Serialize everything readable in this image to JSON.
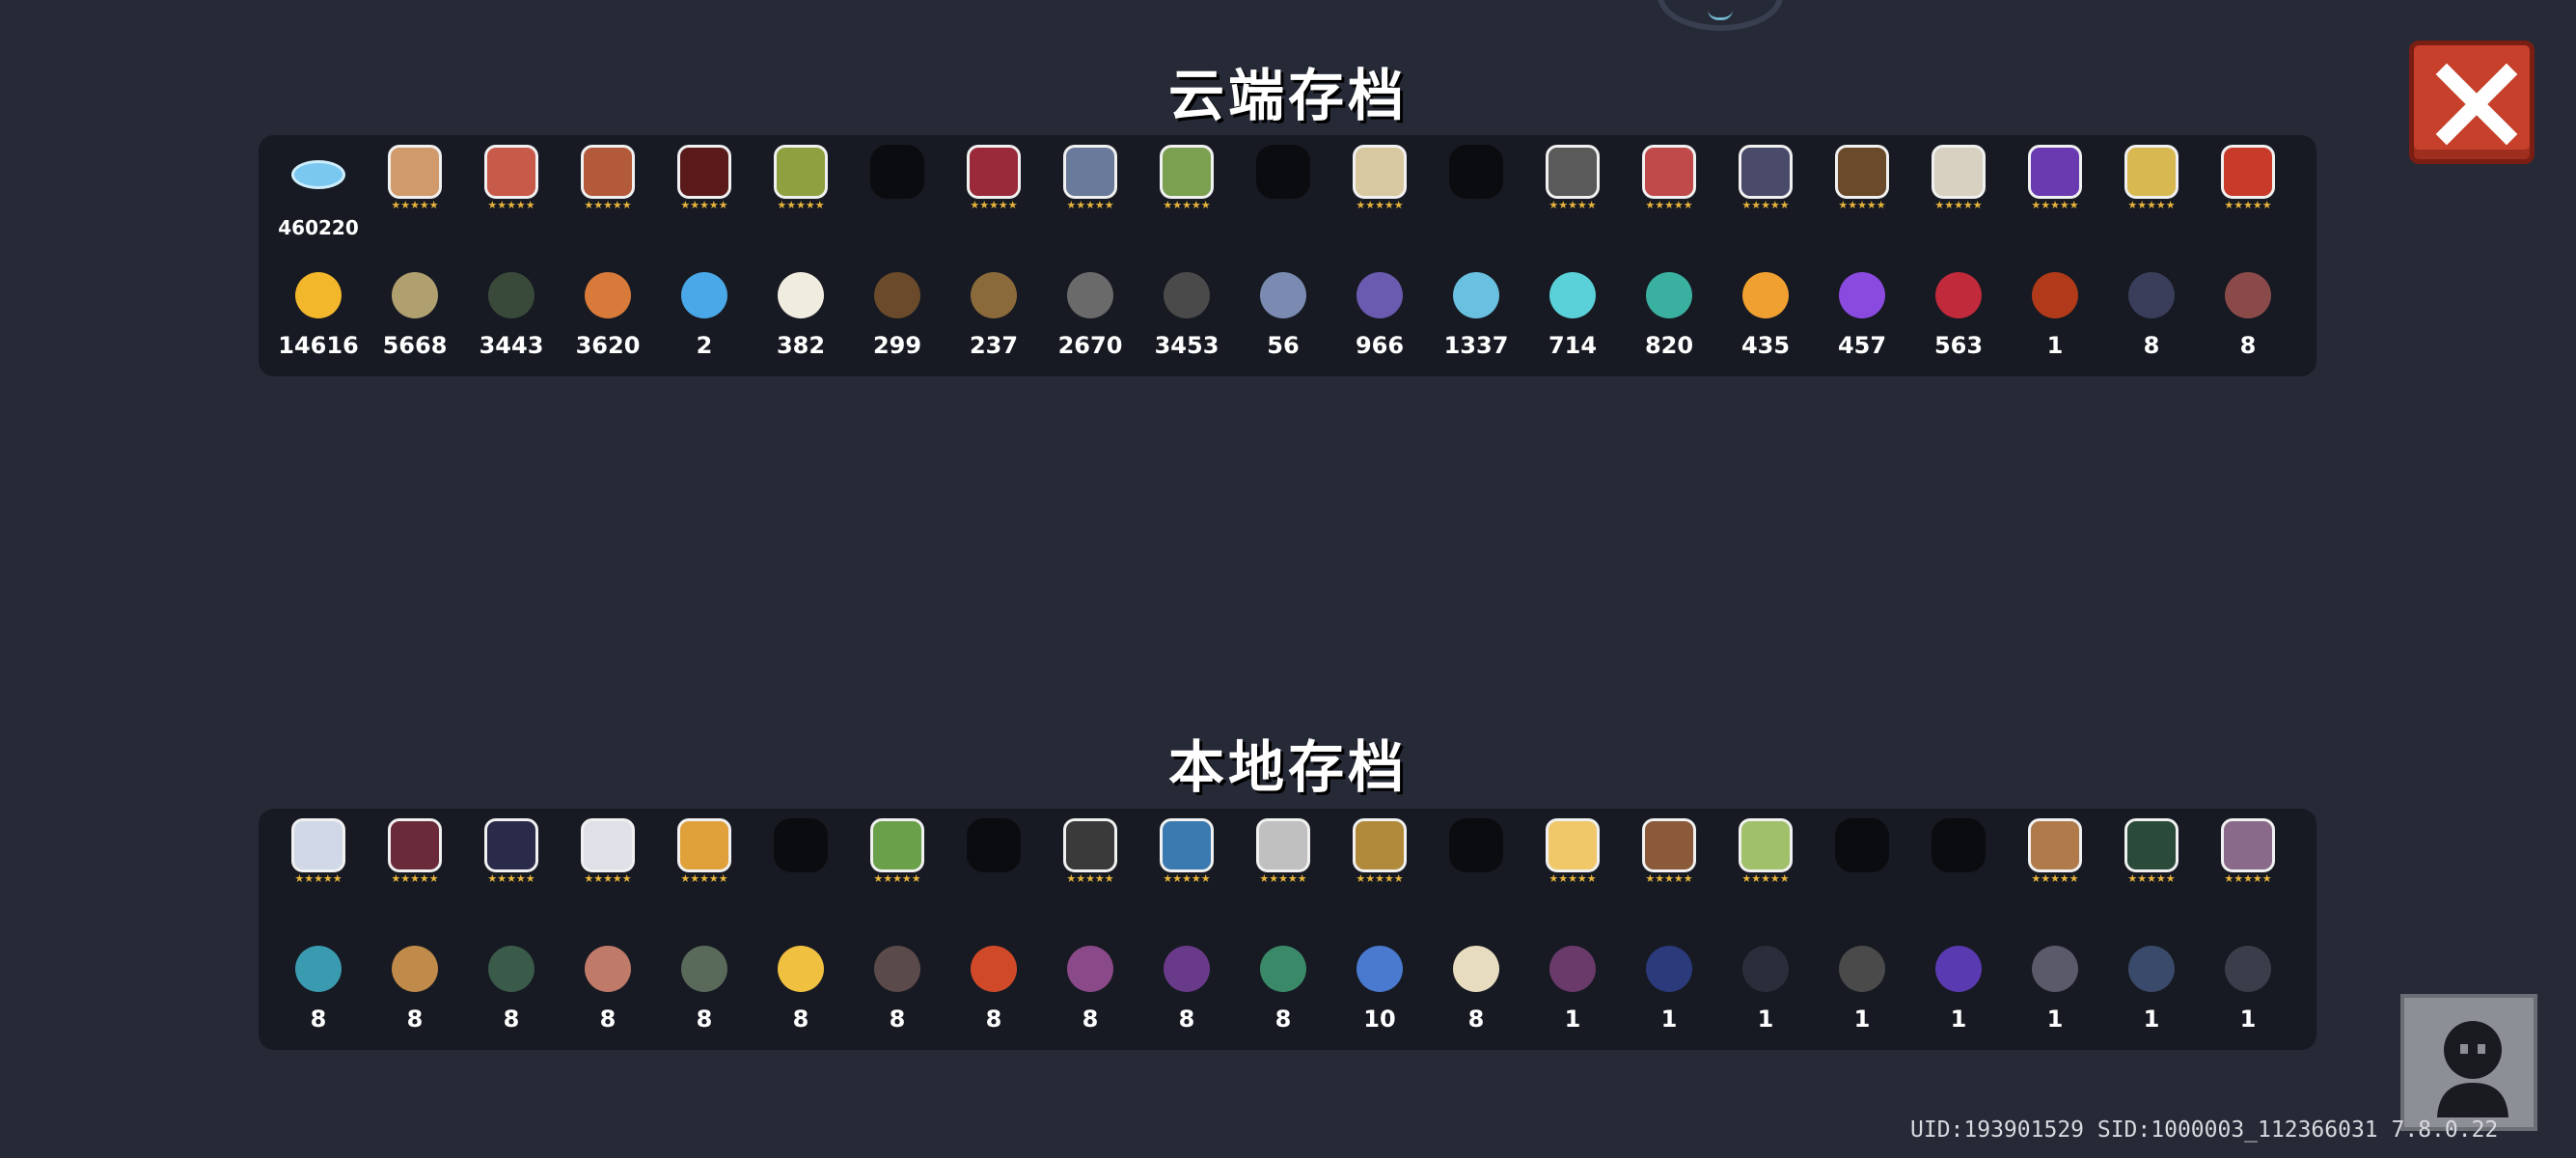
{
  "cloud_title": "云端存档",
  "local_title": "本地存档",
  "uid_line": "UID:193901529 SID:1000003_112366031 7.8.0.22",
  "cloud": {
    "characters": [
      {
        "kind": "gems",
        "label": "460220"
      },
      {
        "kind": "char",
        "color": "#d09a6a",
        "stars": "★★★★★"
      },
      {
        "kind": "char",
        "color": "#c85a4a",
        "stars": "★★★★★"
      },
      {
        "kind": "char",
        "color": "#b25a3a",
        "stars": "★★★★★"
      },
      {
        "kind": "char",
        "color": "#5a1a1a",
        "stars": "★★★★★"
      },
      {
        "kind": "char",
        "color": "#8ea040",
        "stars": "★★★★★"
      },
      {
        "kind": "locked"
      },
      {
        "kind": "char",
        "color": "#9a2a3a",
        "stars": "★★★★★"
      },
      {
        "kind": "char",
        "color": "#6a7a9a",
        "stars": "★★★★★"
      },
      {
        "kind": "char",
        "color": "#7aa050",
        "stars": "★★★★★"
      },
      {
        "kind": "locked"
      },
      {
        "kind": "char",
        "color": "#d8c8a0",
        "stars": "★★★★★"
      },
      {
        "kind": "locked"
      },
      {
        "kind": "char",
        "color": "#5a5a5a",
        "stars": "★★★★★"
      },
      {
        "kind": "char",
        "color": "#c04a4a",
        "stars": "★★★★★"
      },
      {
        "kind": "char",
        "color": "#4a4a6a",
        "stars": "★★★★★"
      },
      {
        "kind": "char",
        "color": "#6a4a2a",
        "stars": "★★★★★"
      },
      {
        "kind": "char",
        "color": "#d8d0c0",
        "stars": "★★★★★"
      },
      {
        "kind": "char",
        "color": "#6a3ab0",
        "stars": "★★★★★"
      },
      {
        "kind": "char",
        "color": "#d8b850",
        "stars": "★★★★★"
      },
      {
        "kind": "char",
        "color": "#c83a2a",
        "stars": "★★★★★"
      }
    ],
    "materials": [
      {
        "color": "#f2b72a",
        "count": "14616"
      },
      {
        "color": "#b0a070",
        "count": "5668"
      },
      {
        "color": "#3a4a3a",
        "count": "3443"
      },
      {
        "color": "#d87a3a",
        "count": "3620"
      },
      {
        "color": "#4aa8e8",
        "count": "2"
      },
      {
        "color": "#f0ece0",
        "count": "382"
      },
      {
        "color": "#6a4a2a",
        "count": "299"
      },
      {
        "color": "#8a6a3a",
        "count": "237"
      },
      {
        "color": "#6a6a6a",
        "count": "2670"
      },
      {
        "color": "#4a4a4a",
        "count": "3453"
      },
      {
        "color": "#7a8ab0",
        "count": "56"
      },
      {
        "color": "#6a5ab0",
        "count": "966"
      },
      {
        "color": "#6ac0e0",
        "count": "1337"
      },
      {
        "color": "#5ad0d8",
        "count": "714"
      },
      {
        "color": "#3ab0a0",
        "count": "820"
      },
      {
        "color": "#f0a030",
        "count": "435"
      },
      {
        "color": "#8a4ae0",
        "count": "457"
      },
      {
        "color": "#c02a3a",
        "count": "563"
      },
      {
        "color": "#b03a1a",
        "count": "1"
      },
      {
        "color": "#3a3e5a",
        "count": "8"
      },
      {
        "color": "#8a4a4a",
        "count": "8"
      }
    ]
  },
  "local": {
    "characters": [
      {
        "kind": "char",
        "color": "#d0d8e8",
        "stars": "★★★★★"
      },
      {
        "kind": "char",
        "color": "#6a2a3a",
        "stars": "★★★★★"
      },
      {
        "kind": "char",
        "color": "#2a2a4a",
        "stars": "★★★★★"
      },
      {
        "kind": "char",
        "color": "#e0e0e8",
        "stars": "★★★★★"
      },
      {
        "kind": "char",
        "color": "#e0a03a",
        "stars": "★★★★★"
      },
      {
        "kind": "locked"
      },
      {
        "kind": "char",
        "color": "#6aa04a",
        "stars": "★★★★★"
      },
      {
        "kind": "locked"
      },
      {
        "kind": "char",
        "color": "#3a3a3a",
        "stars": "★★★★★"
      },
      {
        "kind": "char",
        "color": "#3a7ab0",
        "stars": "★★★★★"
      },
      {
        "kind": "char",
        "color": "#c0c0c0",
        "stars": "★★★★★"
      },
      {
        "kind": "char",
        "color": "#b08a3a",
        "stars": "★★★★★"
      },
      {
        "kind": "locked"
      },
      {
        "kind": "char",
        "color": "#f0c86a",
        "stars": "★★★★★"
      },
      {
        "kind": "char",
        "color": "#8a5a3a",
        "stars": "★★★★★"
      },
      {
        "kind": "char",
        "color": "#a0c06a",
        "stars": "★★★★★"
      },
      {
        "kind": "locked"
      },
      {
        "kind": "locked"
      },
      {
        "kind": "char",
        "color": "#b07a4a",
        "stars": "★★★★★"
      },
      {
        "kind": "char",
        "color": "#2a4a3a",
        "stars": "★★★★★"
      },
      {
        "kind": "char",
        "color": "#8a6a8a",
        "stars": "★★★★★"
      }
    ],
    "materials": [
      {
        "color": "#3a9ab0",
        "count": "8"
      },
      {
        "color": "#c08a4a",
        "count": "8"
      },
      {
        "color": "#3a5a4a",
        "count": "8"
      },
      {
        "color": "#c07a6a",
        "count": "8"
      },
      {
        "color": "#5a6a5a",
        "count": "8"
      },
      {
        "color": "#f0c040",
        "count": "8"
      },
      {
        "color": "#5a4a4a",
        "count": "8"
      },
      {
        "color": "#d04a2a",
        "count": "8"
      },
      {
        "color": "#8a4a8a",
        "count": "8"
      },
      {
        "color": "#6a3a8a",
        "count": "8"
      },
      {
        "color": "#3a8a6a",
        "count": "8"
      },
      {
        "color": "#4a7ad0",
        "count": "10"
      },
      {
        "color": "#e8dcc0",
        "count": "8"
      },
      {
        "color": "#6a3a6a",
        "count": "1"
      },
      {
        "color": "#2a3a7a",
        "count": "1"
      },
      {
        "color": "#2a2e3a",
        "count": "1"
      },
      {
        "color": "#4a4a4a",
        "count": "1"
      },
      {
        "color": "#5a3ab0",
        "count": "1"
      },
      {
        "color": "#5a5a6a",
        "count": "1"
      },
      {
        "color": "#3a4a6a",
        "count": "1"
      },
      {
        "color": "#3a3e4a",
        "count": "1"
      }
    ]
  }
}
